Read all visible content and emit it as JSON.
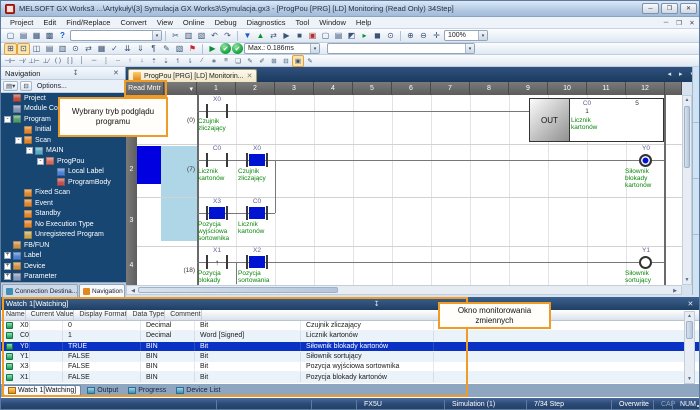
{
  "window": {
    "title": "MELSOFT GX Works3 ...\\Artykuły\\[3] Symulacja GX Works3\\Symulacja.gx3 - [ProgPou [PRG] [LD] Monitoring (Read Only) 34Step]",
    "buttons": {
      "minimize": "─",
      "restore": "❐",
      "close": "✕"
    },
    "mdi_buttons": {
      "minimize": "─",
      "restore": "❐",
      "close": "✕"
    }
  },
  "menu": [
    "Project",
    "Edit",
    "Find/Replace",
    "Convert",
    "View",
    "Online",
    "Debug",
    "Diagnostics",
    "Tool",
    "Window",
    "Help"
  ],
  "toolbar1": {
    "file_icons": [
      {
        "name": "new-project-icon",
        "glyph": "▢"
      },
      {
        "name": "open-project-icon",
        "glyph": "▤"
      },
      {
        "name": "save-project-icon",
        "glyph": "▦"
      },
      {
        "name": "save-all-icon",
        "glyph": "▩"
      },
      {
        "name": "help-icon",
        "glyph": "?"
      }
    ],
    "project_combo": "",
    "edit_icons": [
      {
        "name": "cut-icon",
        "glyph": "✂"
      },
      {
        "name": "copy-icon",
        "glyph": "▥"
      },
      {
        "name": "paste-icon",
        "glyph": "▧"
      },
      {
        "name": "undo-icon",
        "glyph": "↶"
      },
      {
        "name": "redo-icon",
        "glyph": "↷"
      }
    ],
    "online_icons": [
      {
        "name": "write-to-plc-icon",
        "glyph": "▼"
      },
      {
        "name": "read-from-plc-icon",
        "glyph": "▲"
      },
      {
        "name": "verify-with-plc-icon",
        "glyph": "⇄"
      },
      {
        "name": "remote-run-icon",
        "glyph": "▶"
      },
      {
        "name": "remote-stop-icon",
        "glyph": "■"
      },
      {
        "name": "monitor-start-icon",
        "glyph": "▣"
      },
      {
        "name": "monitor-stop-icon",
        "glyph": "▢"
      },
      {
        "name": "device-batch-monitor-icon",
        "glyph": "▤"
      },
      {
        "name": "watch-window-icon",
        "glyph": "◩"
      },
      {
        "name": "simulation-start-icon",
        "glyph": "▸"
      },
      {
        "name": "simulation-stop-icon",
        "glyph": "◼"
      },
      {
        "name": "cross-reference-icon",
        "glyph": "⊙"
      }
    ],
    "zoom_icons": [
      {
        "name": "zoom-in-icon",
        "glyph": "⊕"
      },
      {
        "name": "zoom-out-icon",
        "glyph": "⊖"
      },
      {
        "name": "zoom-fit-icon",
        "glyph": "✛"
      }
    ],
    "zoom_level": "100%"
  },
  "toolbar2": {
    "icons": [
      {
        "name": "navigation-window-icon",
        "glyph": "⊞"
      },
      {
        "name": "element-selection-icon",
        "glyph": "⊡"
      },
      {
        "name": "module-configuration-icon",
        "glyph": "◫"
      },
      {
        "name": "program-editor-icon",
        "glyph": "▤"
      },
      {
        "name": "label-editor-icon",
        "glyph": "▥"
      },
      {
        "name": "find-replace-icon",
        "glyph": "⊙"
      },
      {
        "name": "cross-reference-window-icon",
        "glyph": "⇄"
      },
      {
        "name": "device-list-icon",
        "glyph": "▦"
      },
      {
        "name": "check-program-icon",
        "glyph": "✓"
      },
      {
        "name": "convert-icon",
        "glyph": "⇊"
      },
      {
        "name": "rebuild-all-icon",
        "glyph": "⇓"
      },
      {
        "name": "statement-display-icon",
        "glyph": "¶"
      },
      {
        "name": "device-comment-icon",
        "glyph": "✎"
      },
      {
        "name": "option-display-icon",
        "glyph": "▧"
      },
      {
        "name": "breakpoint-icon",
        "glyph": "⚑"
      }
    ],
    "play_icon": {
      "name": "play-icon",
      "glyph": "▶"
    },
    "check_icons": [
      {
        "name": "simulation-ok-icon",
        "glyph": "✔"
      },
      {
        "name": "monitor-ok-icon",
        "glyph": "✔"
      }
    ],
    "max_scan_label": "Max.: 0.186ms",
    "empty_combo": ""
  },
  "toolbar3": {
    "icons": [
      {
        "name": "open-contact-icon",
        "glyph": "⊣⊢"
      },
      {
        "name": "close-contact-icon",
        "glyph": "⊣∕"
      },
      {
        "name": "open-branch-icon",
        "glyph": "⊥⊢"
      },
      {
        "name": "close-branch-icon",
        "glyph": "⊥∕"
      },
      {
        "name": "coil-icon",
        "glyph": "( )"
      },
      {
        "name": "application-instruction-icon",
        "glyph": "[ ]"
      },
      {
        "name": "vertical-line-icon",
        "glyph": "│"
      },
      {
        "name": "horizontal-line-icon",
        "glyph": "─"
      },
      {
        "name": "delete-vertical-line-icon",
        "glyph": "┆"
      },
      {
        "name": "delete-horizontal-line-icon",
        "glyph": "┄"
      },
      {
        "name": "rising-pulse-icon",
        "glyph": "↑"
      },
      {
        "name": "falling-pulse-icon",
        "glyph": "↓"
      },
      {
        "name": "rising-pulse-branch-icon",
        "glyph": "⇡"
      },
      {
        "name": "falling-pulse-branch-icon",
        "glyph": "⇣"
      },
      {
        "name": "rising-pulse-close-icon",
        "glyph": "↿"
      },
      {
        "name": "falling-pulse-close-icon",
        "glyph": "⇂"
      },
      {
        "name": "invert-operation-icon",
        "glyph": "∕"
      },
      {
        "name": "pulse-conversion-icon",
        "glyph": "∗"
      },
      {
        "name": "inline-st-icon",
        "glyph": "≡"
      },
      {
        "name": "edit-comment-icon",
        "glyph": "❏"
      },
      {
        "name": "edit-statement-icon",
        "glyph": "✎"
      },
      {
        "name": "edit-note-icon",
        "glyph": "✐"
      },
      {
        "name": "insert-row-icon",
        "glyph": "⊞"
      },
      {
        "name": "delete-row-icon",
        "glyph": "⊟"
      },
      {
        "name": "monitor-mode-icon",
        "glyph": "▣"
      },
      {
        "name": "edit-mode-icon",
        "glyph": "✎"
      }
    ]
  },
  "nav": {
    "title": "Navigation",
    "pin_icon": "↧",
    "close_icon": "✕",
    "buttons": [
      {
        "name": "tree-display-mode-icon",
        "glyph": "▤▾"
      },
      {
        "name": "collapse-all-icon",
        "glyph": "⊟"
      }
    ],
    "options_label": "Options...",
    "tree": [
      {
        "label": "Project",
        "level": 0,
        "expander": "",
        "icon_color": "#bf4a3c"
      },
      {
        "label": "Module Configuration",
        "level": 1,
        "expander": "",
        "icon_color": "#8093b3"
      },
      {
        "label": "Program",
        "level": 1,
        "expander": "-",
        "icon_color": "#4f9e68"
      },
      {
        "label": "Initial",
        "level": 2,
        "expander": "",
        "icon_color": "#e0862a"
      },
      {
        "label": "Scan",
        "level": 2,
        "expander": "-",
        "icon_color": "#e0862a"
      },
      {
        "label": "MAIN",
        "level": 3,
        "expander": "-",
        "icon_color": "#58a8c8"
      },
      {
        "label": "ProgPou",
        "level": 4,
        "expander": "-",
        "icon_color": "#d86a5a"
      },
      {
        "label": "Local Label",
        "level": 5,
        "expander": "",
        "icon_color": "#4a7fd4"
      },
      {
        "label": "ProgramBody",
        "level": 5,
        "expander": "",
        "icon_color": "#c05050"
      },
      {
        "label": "Fixed Scan",
        "level": 2,
        "expander": "",
        "icon_color": "#e0862a"
      },
      {
        "label": "Event",
        "level": 2,
        "expander": "",
        "icon_color": "#e0862a"
      },
      {
        "label": "Standby",
        "level": 2,
        "expander": "",
        "icon_color": "#e0862a"
      },
      {
        "label": "No Execution Type",
        "level": 2,
        "expander": "",
        "icon_color": "#e0862a"
      },
      {
        "label": "Unregistered Program",
        "level": 2,
        "expander": "",
        "icon_color": "#c8a84a"
      },
      {
        "label": "FB/FUN",
        "level": 1,
        "expander": "",
        "icon_color": "#d09040"
      },
      {
        "label": "Label",
        "level": 1,
        "expander": "+",
        "icon_color": "#4a7fd4"
      },
      {
        "label": "Device",
        "level": 1,
        "expander": "+",
        "icon_color": "#d09040"
      },
      {
        "label": "Parameter",
        "level": 1,
        "expander": "+",
        "icon_color": "#8898b8"
      }
    ],
    "tabs": [
      {
        "label": "Connection Destina...",
        "icon_color": "#3f8fb5"
      },
      {
        "label": "Navigation",
        "icon_color": "#e08a1e"
      }
    ],
    "active_tab_index": 1
  },
  "doc": {
    "tab_label": "ProgPou [PRG] [LD] Monitorin...",
    "tab_close": "✕",
    "scroll_arrows": "◂ ▸ ▾"
  },
  "ladder": {
    "mode_label": "Read Mntr",
    "header_dropdown": "▾",
    "columns": [
      "1",
      "2",
      "3",
      "4",
      "5",
      "6",
      "7",
      "8",
      "9",
      "10",
      "11",
      "12"
    ],
    "row_numbers": [
      "1",
      "2",
      "3",
      "4"
    ],
    "rungs": [
      {
        "step": "(0)",
        "contacts": [
          {
            "device": "X0",
            "kind": "no",
            "on": false,
            "comment": "Czujnik zliczający"
          }
        ],
        "out": {
          "instr": "OUT",
          "device": "C0",
          "current": "1",
          "preset": "5",
          "comment": "Licznik kartonów"
        }
      },
      {
        "step": "(7)",
        "contacts": [
          {
            "device": "C0",
            "kind": "no",
            "on": false,
            "comment": "Licznik kartonów"
          },
          {
            "device": "X0",
            "kind": "nc",
            "on": true,
            "comment": "Czujnik zliczający"
          }
        ],
        "coil": {
          "device": "Y0",
          "on": true,
          "comment": "Siłownik blokady kartonów"
        }
      },
      {
        "step": "",
        "contacts": [
          {
            "device": "X3",
            "kind": "no",
            "on": true,
            "comment": "Pozycja wyjściowa sortownika"
          },
          {
            "device": "C0",
            "kind": "no",
            "on": true,
            "comment": "Licznik kartonów"
          }
        ]
      },
      {
        "step": "(18)",
        "contacts": [
          {
            "device": "X1",
            "kind": "pulse",
            "on": false,
            "comment": "Pozycja blokady kartonów"
          },
          {
            "device": "X2",
            "kind": "no",
            "on": true,
            "comment": "Pozycja sortowania"
          }
        ],
        "coil": {
          "device": "Y1",
          "on": false,
          "comment": "Siłownik sortujący"
        }
      }
    ]
  },
  "watch": {
    "title": "Watch 1[Watching]",
    "pin_icon": "↧",
    "close_icon": "✕",
    "headers": [
      "Name",
      "Current Value",
      "Display Format",
      "Data Type",
      "Comment"
    ],
    "rows": [
      {
        "name": "X0",
        "value": "0",
        "format": "Decimal",
        "type": "Bit",
        "comment": "Czujnik zliczający"
      },
      {
        "name": "C0",
        "value": "1",
        "format": "Decimal",
        "type": "Word [Signed]",
        "comment": "Licznik kartonów"
      },
      {
        "name": "Y0",
        "value": "TRUE",
        "format": "BIN",
        "type": "Bit",
        "comment": "Siłownik blokady kartonów"
      },
      {
        "name": "Y1",
        "value": "FALSE",
        "format": "BIN",
        "type": "Bit",
        "comment": "Siłownik sortujący"
      },
      {
        "name": "X3",
        "value": "FALSE",
        "format": "BIN",
        "type": "Bit",
        "comment": "Pozycja wyjściowa sortownika"
      },
      {
        "name": "X1",
        "value": "FALSE",
        "format": "BIN",
        "type": "Bit",
        "comment": "Pozycja blokady kartonów"
      }
    ],
    "selected_index": 2,
    "tabs": [
      {
        "label": "Watch 1[Watching]"
      },
      {
        "label": "Output"
      },
      {
        "label": "Progress"
      },
      {
        "label": "Device List"
      }
    ],
    "active_tab_index": 0
  },
  "status": {
    "plc_type": "FX5U",
    "mode": "Simulation (1)",
    "step": "7/34 Step",
    "insert_mode": "Overwrite",
    "cap": "CAP",
    "num": "NUM"
  },
  "annotations": {
    "callout_mode": "Wybrany tryb podglądu programu",
    "callout_watch": "Okno monitorowania zmiennych"
  }
}
